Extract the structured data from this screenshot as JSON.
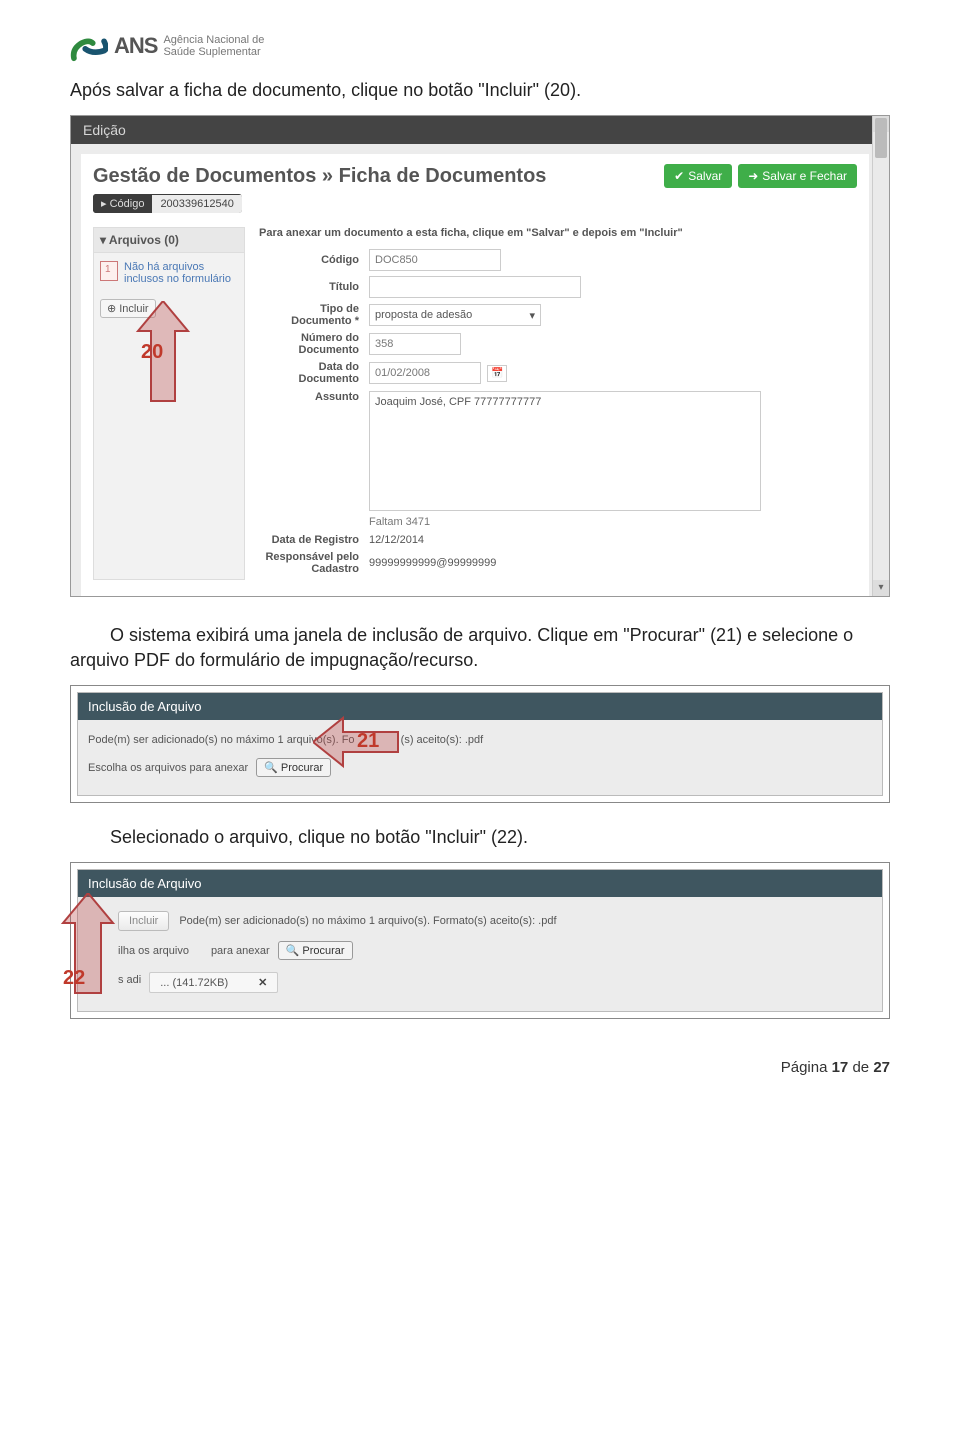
{
  "logo": {
    "acronym": "ANS",
    "line1": "Agência Nacional de",
    "line2": "Saúde Suplementar"
  },
  "text": {
    "p1": "Após salvar a ficha de documento, clique no botão \"Incluir\" (20).",
    "p2_a": "O sistema exibirá uma janela de inclusão de arquivo. Clique em \"Procurar\" (21) e selecione o",
    "p2_b": "arquivo PDF do formulário de impugnação/recurso.",
    "p3": "Selecionado o arquivo, clique no botão \"Incluir\" (22)."
  },
  "callouts": {
    "n20": "20",
    "n21": "21",
    "n22": "22"
  },
  "shot1": {
    "editbar": "Edição",
    "title": "Gestão de Documentos » Ficha de Documentos",
    "btn_salvar": "Salvar",
    "btn_salvar_fechar": "Salvar e Fechar",
    "chip_label": "Código",
    "chip_val": "200339612540",
    "side_head": "Arquivos (0)",
    "side_empty": "Não há arquivos inclusos no formulário",
    "side_incluir": "Incluir",
    "instr": "Para anexar um documento a esta ficha, clique em \"Salvar\" e depois em \"Incluir\"",
    "labels": {
      "codigo": "Código",
      "titulo": "Título",
      "tipo": "Tipo de Documento *",
      "numero": "Número do Documento",
      "data": "Data do Documento",
      "assunto": "Assunto",
      "registro": "Data de Registro",
      "responsavel": "Responsável pelo Cadastro"
    },
    "vals": {
      "codigo": "DOC850",
      "tipo": "proposta de adesão",
      "numero": "358",
      "data": "01/02/2008",
      "assunto": "Joaquim José, CPF 77777777777",
      "faltam": "Faltam 3471",
      "registro": "12/12/2014",
      "responsavel": "99999999999@99999999"
    }
  },
  "shot2": {
    "title": "Inclusão de Arquivo",
    "info_a": "Pode(m) ser adicionado(s) no máximo 1 arquivo(s). Fo",
    "info_b": "(s) aceito(s): .pdf",
    "browse_label": "Escolha os arquivos para anexar",
    "browse_btn": "Procurar"
  },
  "shot3": {
    "title": "Inclusão de Arquivo",
    "incluir_btn": "Incluir",
    "info": "Pode(m) ser adicionado(s) no máximo 1 arquivo(s). Formato(s) aceito(s): .pdf",
    "browse_label_a": "ilha os arquivo",
    "browse_label_b": "para anexar",
    "browse_btn": "Procurar",
    "file_row_a": "s adi",
    "file_name": "... (141.72KB)",
    "file_x": "✕"
  },
  "footer": {
    "prefix": "Página ",
    "num": "17",
    "of": " de ",
    "total": "27"
  }
}
